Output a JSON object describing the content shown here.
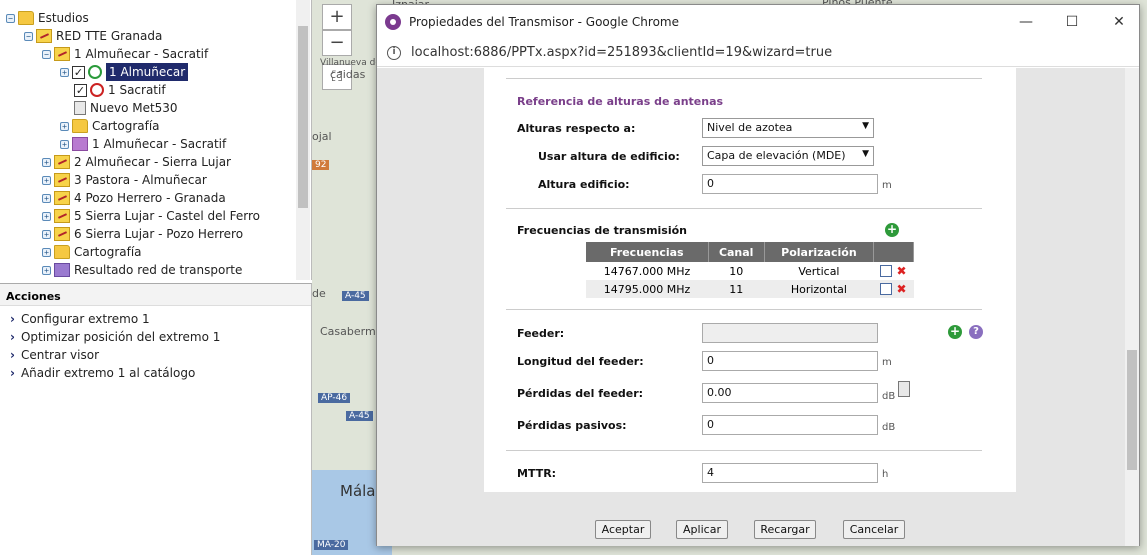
{
  "tree": {
    "items": [
      {
        "label": "Estudios"
      },
      {
        "label": "RED TTE Granada"
      },
      {
        "label": "1 Almuñecar - Sacratif"
      },
      {
        "label": "1 Almuñecar"
      },
      {
        "label": "1 Sacratif"
      },
      {
        "label": "Nuevo Met530"
      },
      {
        "label": "Cartografía"
      },
      {
        "label": "1 Almuñecar - Sacratif"
      },
      {
        "label": "2 Almuñecar - Sierra Lujar"
      },
      {
        "label": "3 Pastora - Almuñecar"
      },
      {
        "label": "4 Pozo Herrero - Granada"
      },
      {
        "label": "5 Sierra Lujar - Castel del Ferro"
      },
      {
        "label": "6 Sierra Lujar - Pozo Herrero"
      },
      {
        "label": "Cartografía"
      },
      {
        "label": "Resultado red de transporte"
      }
    ]
  },
  "actions": {
    "title": "Acciones",
    "items": [
      "Configurar extremo 1",
      "Optimizar posición del extremo 1",
      "Centrar visor",
      "Añadir extremo 1 al catálogo"
    ]
  },
  "map": {
    "zoom_in": "+",
    "zoom_out": "−",
    "labels": [
      "Iznajar",
      "Villanueva del",
      "caidas",
      "ojal",
      "92",
      "de",
      "A-45",
      "Casaberm",
      "AP-46",
      "A-45",
      "Mála",
      "MA-20",
      "Pinos Puente"
    ]
  },
  "window": {
    "title": "Propiedades del Transmisor - Google Chrome",
    "url": "localhost:6886/PPTx.aspx?id=251893&clientId=19&wizard=true"
  },
  "form": {
    "section_heights": "Referencia de alturas de antenas",
    "heights_label": "Alturas respecto a:",
    "heights_value": "Nivel de azotea",
    "use_building_label": "Usar altura de edificio:",
    "use_building_value": "Capa de elevación (MDE)",
    "building_height_label": "Altura edificio:",
    "building_height_value": "0",
    "building_height_unit": "m",
    "freq_label": "Frecuencias de transmisión",
    "freq_table": {
      "headers": [
        "Frecuencias",
        "Canal",
        "Polarización"
      ],
      "rows": [
        {
          "freq": "14767.000 MHz",
          "canal": "10",
          "pol": "Vertical"
        },
        {
          "freq": "14795.000 MHz",
          "canal": "11",
          "pol": "Horizontal"
        }
      ]
    },
    "feeder_label": "Feeder:",
    "feeder_value": "",
    "feeder_len_label": "Longitud del feeder:",
    "feeder_len_value": "0",
    "feeder_len_unit": "m",
    "feeder_loss_label": "Pérdidas del feeder:",
    "feeder_loss_value": "0.00",
    "feeder_loss_unit": "dB",
    "passive_loss_label": "Pérdidas pasivos:",
    "passive_loss_value": "0",
    "passive_loss_unit": "dB",
    "mttr_label": "MTTR:",
    "mttr_value": "4",
    "mttr_unit": "h"
  },
  "buttons": {
    "accept": "Aceptar",
    "apply": "Aplicar",
    "reload": "Recargar",
    "cancel": "Cancelar"
  }
}
